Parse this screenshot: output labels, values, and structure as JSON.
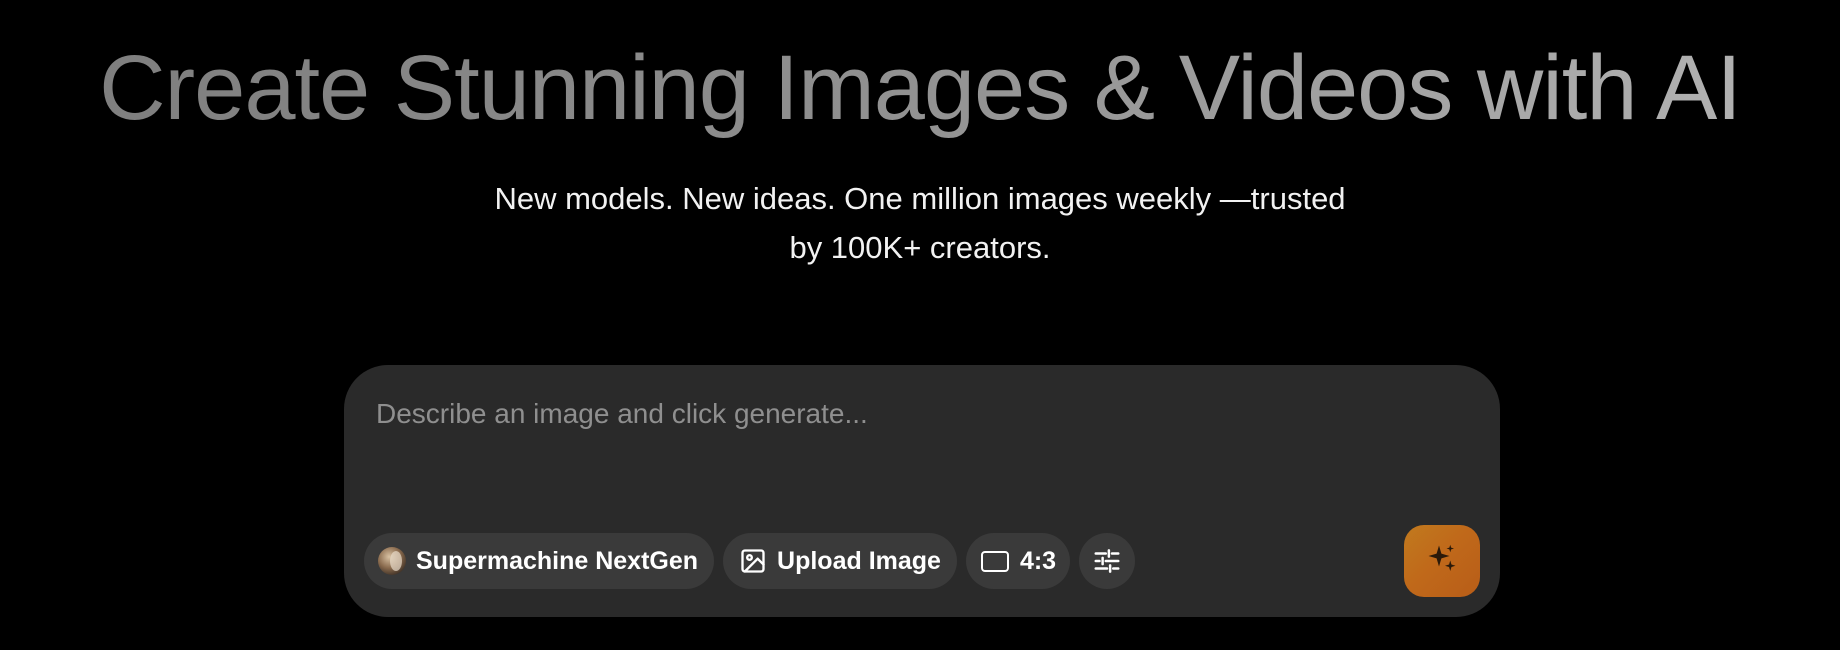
{
  "hero": {
    "headline": "Create Stunning Images & Videos with AI",
    "subhead_line1": "New models. New ideas. One million images weekly —trusted",
    "subhead_line2": "by 100K+ creators."
  },
  "prompt": {
    "placeholder": "Describe an image and click generate...",
    "value": ""
  },
  "toolbar": {
    "model_label": "Supermachine NextGen",
    "model_icon": "model-avatar",
    "upload_label": "Upload Image",
    "upload_icon": "image-icon",
    "ratio_label": "4:3",
    "ratio_icon": "aspect-ratio-icon",
    "settings_icon": "sliders-icon"
  },
  "generate": {
    "icon": "sparkles-icon",
    "accent_color": "#c0691a"
  },
  "colors": {
    "background": "#000000",
    "card": "#2a2a2a",
    "chip": "#3a3a3a"
  }
}
